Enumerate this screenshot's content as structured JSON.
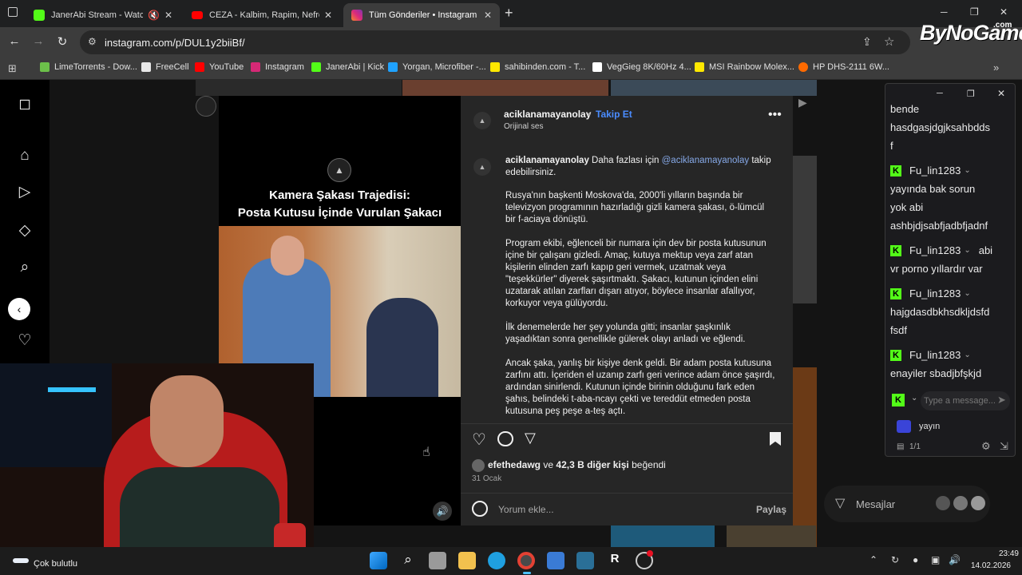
{
  "browser": {
    "tabs": [
      {
        "label": "JanerAbi Stream - Watch Live",
        "icon": "kick-icon"
      },
      {
        "label": "CEZA - Kalbim, Rapim, Nefretim",
        "icon": "youtube-icon"
      },
      {
        "label": "Tüm Gönderiler • Instagram",
        "icon": "instagram-icon",
        "active": true
      }
    ],
    "new_tab": "+",
    "url": "instagram.com/p/DUL1y2biiBf/",
    "watermark": "ByNoGame",
    "watermark_sub": ".com",
    "bookmarks": [
      {
        "label": "LimeTorrents - Dow...",
        "color": "#6cc04a"
      },
      {
        "label": "FreeCell",
        "color": "#e8e8e8"
      },
      {
        "label": "YouTube",
        "color": "#ff0000"
      },
      {
        "label": "Instagram",
        "color": "#d62976"
      },
      {
        "label": "JanerAbi | Kick",
        "color": "#53fc18"
      },
      {
        "label": "Yorgan, Microfiber -...",
        "color": "#1fa2ff"
      },
      {
        "label": "sahibinden.com - T...",
        "color": "#ffe800"
      },
      {
        "label": "VegGieg 8K/60Hz 4...",
        "color": "#ffffff"
      },
      {
        "label": "MSI Rainbow Molex...",
        "color": "#ffe800"
      },
      {
        "label": "HP DHS-2111 6W...",
        "color": "#ff6a00"
      }
    ]
  },
  "post": {
    "username": "aciklanamayanolay",
    "follow": "Takip Et",
    "dot": "•",
    "audio": "Orijinal ses",
    "video_title_1": "Kamera Şakası Trajedisi:",
    "video_title_2": "Posta Kutusu İçinde Vurulan Şakacı",
    "caption_user": "aciklanamayanolay",
    "caption_intro": "Daha fazlası için",
    "caption_mention": "@aciklanamayanolay",
    "caption_intro_end": "takip edebilirsiniz.",
    "paragraphs": [
      "Rusya'nın başkenti Moskova'da, 2000'li yılların başında bir televizyon programının hazırladığı gizli kamera şakası, ö-lümcül bir f-aciaya dönüştü.",
      "Program ekibi, eğlenceli bir numara için dev bir posta kutusunun içine bir çalışanı gizledi. Amaç, kutuya mektup veya zarf atan kişilerin elinden zarfı kapıp geri vermek, uzatmak veya \"teşekkürler\" diyerek şaşırtmaktı. Şakacı, kutunun içinden elini uzatarak atılan zarfları dışarı atıyor, böylece insanlar afallıyor, korkuyor veya gülüyordu.",
      "İlk denemelerde her şey yolunda gitti; insanlar şaşkınlık yaşadıktan sonra genellikle gülerek olayı anladı ve eğlendi.",
      "Ancak şaka, yanlış bir kişiye denk geldi. Bir adam posta kutusuna zarfını attı. İçeriden el uzanıp zarfı geri verince adam önce şaşırdı, ardından sinirlendi. Kutunun içinde birinin olduğunu fark eden şahıs, belindeki t-aba-ncayı çekti ve tereddüt etmeden posta kutusuna peş peşe a-teş açtı."
    ],
    "likes_user": "efethedawg",
    "likes_and": "ve",
    "likes_count": "42,3 B diğer kişi",
    "likes_end": "beğendi",
    "date": "31 Ocak",
    "comment_placeholder": "Yorum ekle...",
    "share": "Paylaş"
  },
  "messages_label": "Mesajlar",
  "chat": {
    "lines_top": [
      "bende",
      "hasdgasjdgjksahbdds",
      "f"
    ],
    "messages": [
      {
        "user": "Fu_lin1283",
        "lines": [
          "yayında bak sorun",
          "yok abi",
          "ashbjdjsabfjadbfjadnf"
        ]
      },
      {
        "user": "Fu_lin1283",
        "inline": "abi",
        "lines": [
          "vr porno yıllardır var"
        ]
      },
      {
        "user": "Fu_lin1283",
        "lines": [
          "hajgdasdbkhsdkljdsfd",
          "fsdf"
        ]
      },
      {
        "user": "Fu_lin1283",
        "lines": [
          "enayiler sbadjbfşkjd"
        ]
      }
    ],
    "placeholder": "Type a message...",
    "stream_label": "yayın",
    "count": "1/1",
    "accent": "#53fc18"
  },
  "taskbar": {
    "weather": "Çok bulutlu",
    "time": "23:49",
    "date": "14.02.2026",
    "accent": "#0078d4"
  }
}
